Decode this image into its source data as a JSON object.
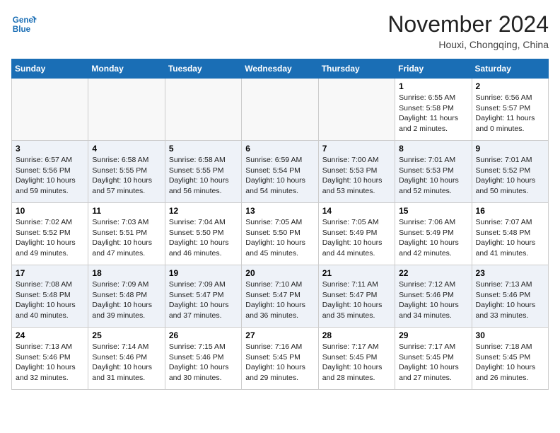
{
  "header": {
    "logo_text_general": "General",
    "logo_text_blue": "Blue",
    "month": "November 2024",
    "location": "Houxi, Chongqing, China"
  },
  "weekdays": [
    "Sunday",
    "Monday",
    "Tuesday",
    "Wednesday",
    "Thursday",
    "Friday",
    "Saturday"
  ],
  "weeks": [
    [
      {
        "day": "",
        "empty": true
      },
      {
        "day": "",
        "empty": true
      },
      {
        "day": "",
        "empty": true
      },
      {
        "day": "",
        "empty": true
      },
      {
        "day": "",
        "empty": true
      },
      {
        "day": "1",
        "sunrise": "6:55 AM",
        "sunset": "5:58 PM",
        "daylight": "11 hours and 2 minutes."
      },
      {
        "day": "2",
        "sunrise": "6:56 AM",
        "sunset": "5:57 PM",
        "daylight": "11 hours and 0 minutes."
      }
    ],
    [
      {
        "day": "3",
        "sunrise": "6:57 AM",
        "sunset": "5:56 PM",
        "daylight": "10 hours and 59 minutes."
      },
      {
        "day": "4",
        "sunrise": "6:58 AM",
        "sunset": "5:55 PM",
        "daylight": "10 hours and 57 minutes."
      },
      {
        "day": "5",
        "sunrise": "6:58 AM",
        "sunset": "5:55 PM",
        "daylight": "10 hours and 56 minutes."
      },
      {
        "day": "6",
        "sunrise": "6:59 AM",
        "sunset": "5:54 PM",
        "daylight": "10 hours and 54 minutes."
      },
      {
        "day": "7",
        "sunrise": "7:00 AM",
        "sunset": "5:53 PM",
        "daylight": "10 hours and 53 minutes."
      },
      {
        "day": "8",
        "sunrise": "7:01 AM",
        "sunset": "5:53 PM",
        "daylight": "10 hours and 52 minutes."
      },
      {
        "day": "9",
        "sunrise": "7:01 AM",
        "sunset": "5:52 PM",
        "daylight": "10 hours and 50 minutes."
      }
    ],
    [
      {
        "day": "10",
        "sunrise": "7:02 AM",
        "sunset": "5:52 PM",
        "daylight": "10 hours and 49 minutes."
      },
      {
        "day": "11",
        "sunrise": "7:03 AM",
        "sunset": "5:51 PM",
        "daylight": "10 hours and 47 minutes."
      },
      {
        "day": "12",
        "sunrise": "7:04 AM",
        "sunset": "5:50 PM",
        "daylight": "10 hours and 46 minutes."
      },
      {
        "day": "13",
        "sunrise": "7:05 AM",
        "sunset": "5:50 PM",
        "daylight": "10 hours and 45 minutes."
      },
      {
        "day": "14",
        "sunrise": "7:05 AM",
        "sunset": "5:49 PM",
        "daylight": "10 hours and 44 minutes."
      },
      {
        "day": "15",
        "sunrise": "7:06 AM",
        "sunset": "5:49 PM",
        "daylight": "10 hours and 42 minutes."
      },
      {
        "day": "16",
        "sunrise": "7:07 AM",
        "sunset": "5:48 PM",
        "daylight": "10 hours and 41 minutes."
      }
    ],
    [
      {
        "day": "17",
        "sunrise": "7:08 AM",
        "sunset": "5:48 PM",
        "daylight": "10 hours and 40 minutes."
      },
      {
        "day": "18",
        "sunrise": "7:09 AM",
        "sunset": "5:48 PM",
        "daylight": "10 hours and 39 minutes."
      },
      {
        "day": "19",
        "sunrise": "7:09 AM",
        "sunset": "5:47 PM",
        "daylight": "10 hours and 37 minutes."
      },
      {
        "day": "20",
        "sunrise": "7:10 AM",
        "sunset": "5:47 PM",
        "daylight": "10 hours and 36 minutes."
      },
      {
        "day": "21",
        "sunrise": "7:11 AM",
        "sunset": "5:47 PM",
        "daylight": "10 hours and 35 minutes."
      },
      {
        "day": "22",
        "sunrise": "7:12 AM",
        "sunset": "5:46 PM",
        "daylight": "10 hours and 34 minutes."
      },
      {
        "day": "23",
        "sunrise": "7:13 AM",
        "sunset": "5:46 PM",
        "daylight": "10 hours and 33 minutes."
      }
    ],
    [
      {
        "day": "24",
        "sunrise": "7:13 AM",
        "sunset": "5:46 PM",
        "daylight": "10 hours and 32 minutes."
      },
      {
        "day": "25",
        "sunrise": "7:14 AM",
        "sunset": "5:46 PM",
        "daylight": "10 hours and 31 minutes."
      },
      {
        "day": "26",
        "sunrise": "7:15 AM",
        "sunset": "5:46 PM",
        "daylight": "10 hours and 30 minutes."
      },
      {
        "day": "27",
        "sunrise": "7:16 AM",
        "sunset": "5:45 PM",
        "daylight": "10 hours and 29 minutes."
      },
      {
        "day": "28",
        "sunrise": "7:17 AM",
        "sunset": "5:45 PM",
        "daylight": "10 hours and 28 minutes."
      },
      {
        "day": "29",
        "sunrise": "7:17 AM",
        "sunset": "5:45 PM",
        "daylight": "10 hours and 27 minutes."
      },
      {
        "day": "30",
        "sunrise": "7:18 AM",
        "sunset": "5:45 PM",
        "daylight": "10 hours and 26 minutes."
      }
    ]
  ]
}
